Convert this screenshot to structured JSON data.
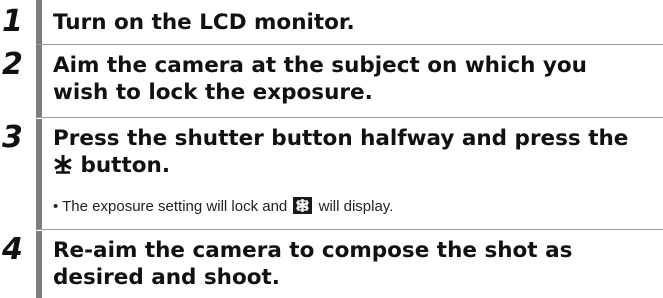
{
  "steps": [
    {
      "number": "1",
      "title": "Turn on the LCD monitor."
    },
    {
      "number": "2",
      "title_line1": "Aim the camera at the subject on which you",
      "title_line2": "wish to lock the exposure."
    },
    {
      "number": "3",
      "title_line1": "Press the shutter button halfway and press the",
      "title_line2_after_icon": " button.",
      "bullet_prefix": "• The exposure setting will lock and ",
      "bullet_suffix": " will display."
    },
    {
      "number": "4",
      "title_line1": "Re-aim the camera to compose the shot as",
      "title_line2": "desired and shoot."
    }
  ],
  "icons": {
    "ae_lock_button": "asterisk-icon",
    "ae_lock_indicator": "ae-lock-indicator-icon"
  },
  "colors": {
    "bar": "#7d7d7d",
    "rule": "#9a9a9a",
    "text": "#111111"
  }
}
